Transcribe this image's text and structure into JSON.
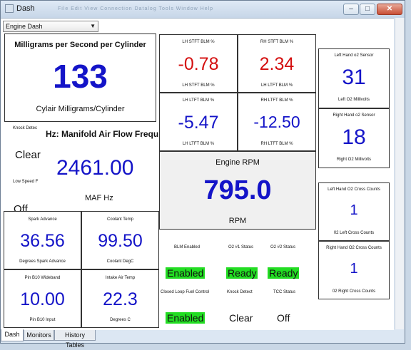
{
  "window": {
    "title": "Dash",
    "ghost_menu": "File  Edit  View  Connection  Datalog  Tools  Window  Help"
  },
  "selector": {
    "value": "Engine Dash"
  },
  "mg_box": {
    "title": "Milligrams per Second per Cylinder",
    "value": "133",
    "label": "Cylair Milligrams/Cylinder"
  },
  "maf": {
    "knock_label": "Knock Detec",
    "knock_value": "Clear",
    "low_speed_label": "Low Speed F",
    "low_speed_value": "Off",
    "title": "Hz: Manifold Air Flow Frequ",
    "value": "2461.00",
    "label": "MAF Hz"
  },
  "blm": [
    {
      "title": "LH STFT BLM %",
      "value": "-0.78",
      "label": "LH STFT BLM %",
      "color": "#d40f0f"
    },
    {
      "title": "RH STFT BLM %",
      "value": "2.34",
      "label": "LH LTFT BLM %",
      "color": "#d40f0f"
    },
    {
      "title": "LH LTFT BLM %",
      "value": "-5.47",
      "label": "LH LTFT BLM %",
      "color": "#1414c8"
    },
    {
      "title": "RH LTFT BLM %",
      "value": "-12.50",
      "label": "RH LTFT BLM %",
      "color": "#1414c8"
    }
  ],
  "rpm": {
    "title": "Engine RPM",
    "value": "795.0",
    "label": "RPM"
  },
  "left_grid": [
    {
      "title": "Spark Advance",
      "value": "36.56",
      "label": "Degrees Spark Advance"
    },
    {
      "title": "Coolant Temp",
      "value": "99.50",
      "label": "Coolant DegC"
    },
    {
      "title": "Pin B10 Wideband",
      "value": "10.00",
      "label": "Pin B10 Input"
    },
    {
      "title": "Intake Air Temp",
      "value": "22.3",
      "label": "Degrees C"
    }
  ],
  "status": [
    {
      "title": "BLM Enabled",
      "value": "Enabled",
      "green": true
    },
    {
      "title": "O2 #1 Status",
      "value": "Ready",
      "green": true
    },
    {
      "title": "O2 #2 Status",
      "value": "Ready",
      "green": true
    },
    {
      "title": "Closed Loop Fuel Control",
      "value": "Enabled",
      "green": true
    },
    {
      "title": "Knock Detect",
      "value": "Clear",
      "green": false
    },
    {
      "title": "TCC Status",
      "value": "Off",
      "green": false
    }
  ],
  "o2": [
    {
      "title": "Left Hand o2 Sensor",
      "value": "31",
      "label": "Left O2 Millivolts"
    },
    {
      "title": "Right Hand o2 Sensor",
      "value": "18",
      "label": "Right O2 Millivolts"
    },
    {
      "title": "Left Hand O2 Cross Counts",
      "value": "1",
      "label": "02 Left Cross Counts"
    },
    {
      "title": "Right Hand O2 Cross Counts",
      "value": "1",
      "label": "02 Right Cross Counts"
    }
  ],
  "tabs": [
    "Dash",
    "Monitors",
    "History Tables"
  ]
}
